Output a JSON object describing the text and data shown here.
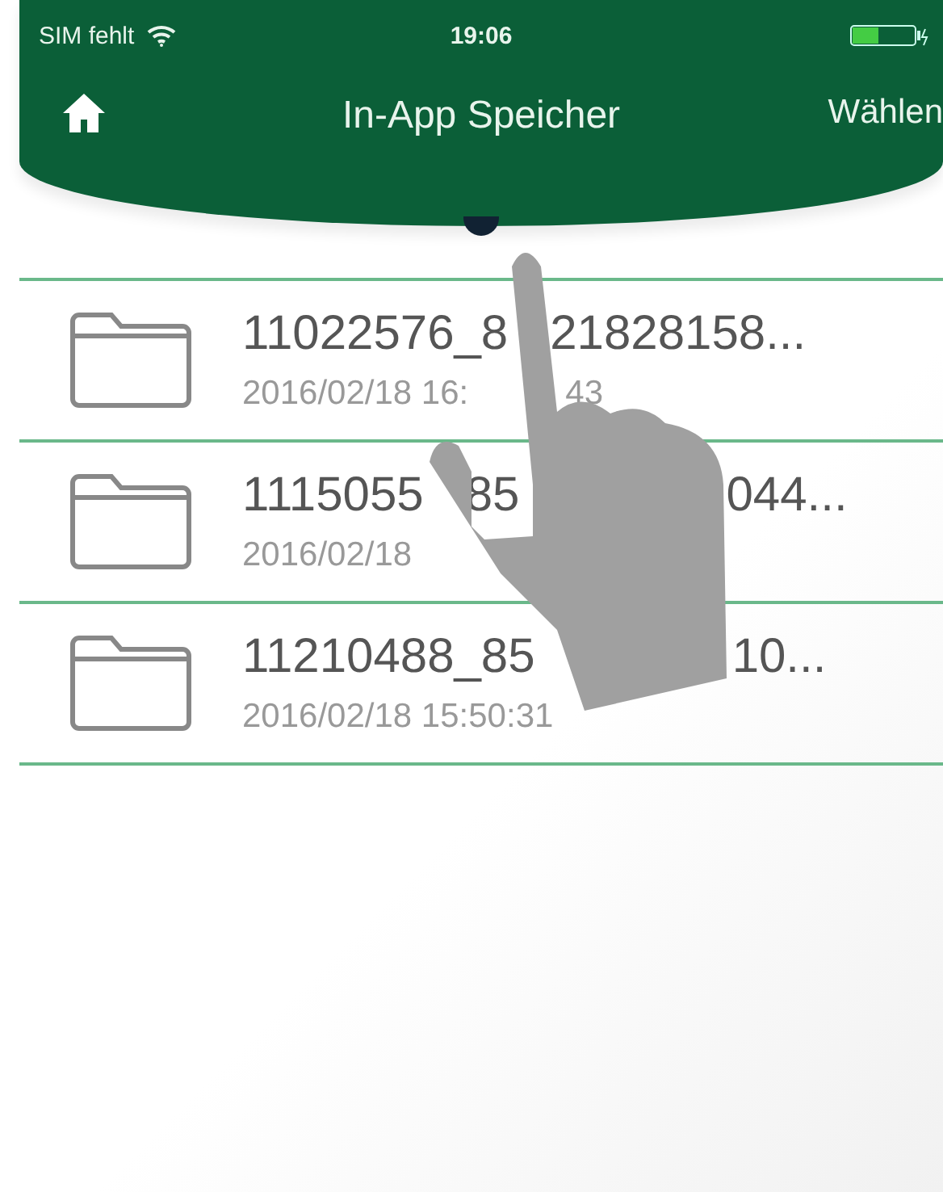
{
  "status_bar": {
    "carrier": "SIM fehlt",
    "time": "19:06"
  },
  "nav": {
    "title": "In-App Speicher",
    "action": "Wählen"
  },
  "files": [
    {
      "name_parts": [
        "11022576_8",
        "21828158..."
      ],
      "date_parts": [
        "2016/02/18 16:",
        "43"
      ]
    },
    {
      "name_parts": [
        "1115055",
        "85",
        "044..."
      ],
      "date_parts": [
        "2016/02/18"
      ]
    },
    {
      "name_parts": [
        "11210488_85",
        "10..."
      ],
      "date_parts": [
        "2016/02/18 15:50:31"
      ]
    }
  ]
}
